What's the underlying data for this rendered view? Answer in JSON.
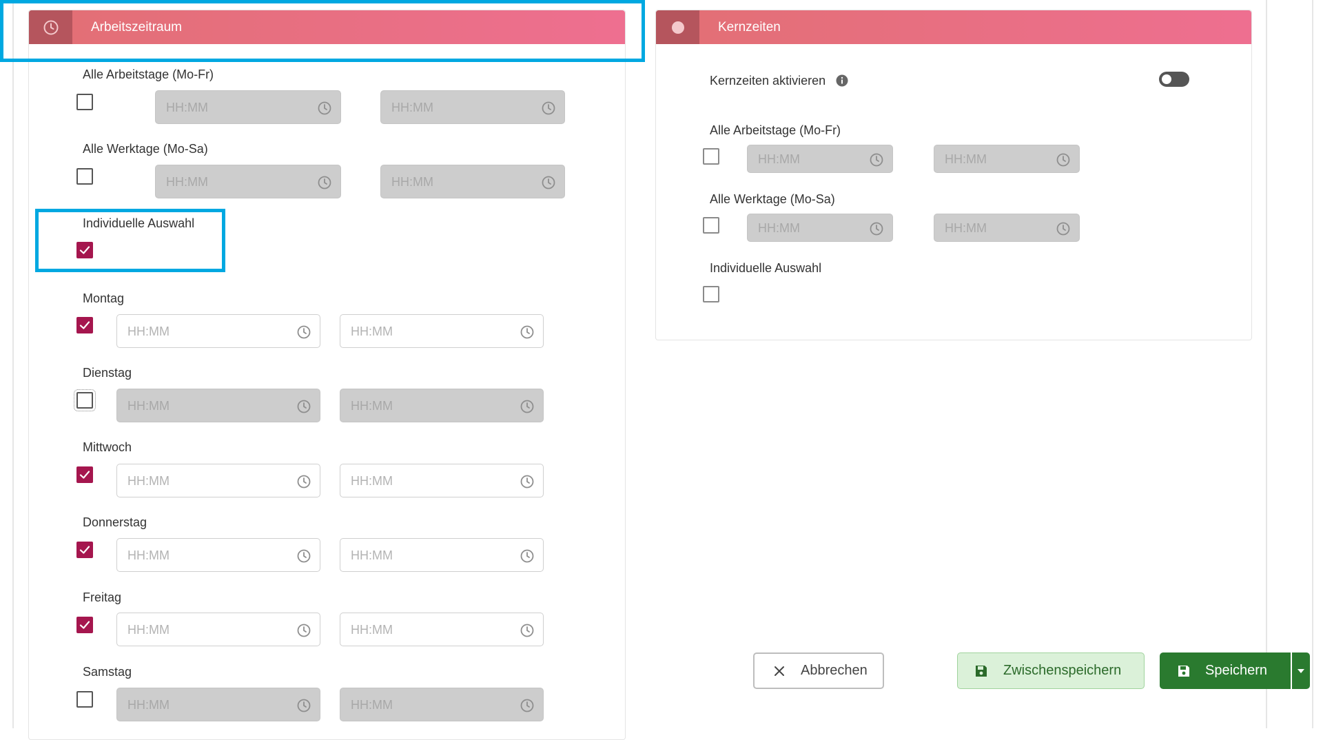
{
  "left_panel": {
    "title": "Arbeitszeitraum",
    "icon": "clock-icon",
    "rows": [
      {
        "label": "Alle Arbeitstage (Mo-Fr)",
        "checked": false,
        "from_placeholder": "HH:MM",
        "to_placeholder": "HH:MM"
      },
      {
        "label": "Alle Werktage (Mo-Sa)",
        "checked": false,
        "from_placeholder": "HH:MM",
        "to_placeholder": "HH:MM"
      },
      {
        "label": "Individuelle Auswahl",
        "checked": true
      },
      {
        "label": "Montag",
        "checked": true,
        "from_placeholder": "HH:MM",
        "to_placeholder": "HH:MM"
      },
      {
        "label": "Dienstag",
        "checked": false,
        "from_placeholder": "HH:MM",
        "to_placeholder": "HH:MM"
      },
      {
        "label": "Mittwoch",
        "checked": true,
        "from_placeholder": "HH:MM",
        "to_placeholder": "HH:MM"
      },
      {
        "label": "Donnerstag",
        "checked": true,
        "from_placeholder": "HH:MM",
        "to_placeholder": "HH:MM"
      },
      {
        "label": "Freitag",
        "checked": true,
        "from_placeholder": "HH:MM",
        "to_placeholder": "HH:MM"
      },
      {
        "label": "Samstag",
        "checked": false,
        "from_placeholder": "HH:MM",
        "to_placeholder": "HH:MM"
      }
    ]
  },
  "right_panel": {
    "title": "Kernzeiten",
    "icon": "circle-icon",
    "activate_label": "Kernzeiten aktivieren",
    "activate_on": false,
    "rows": [
      {
        "label": "Alle Arbeitstage (Mo-Fr)",
        "checked": false,
        "from_placeholder": "HH:MM",
        "to_placeholder": "HH:MM"
      },
      {
        "label": "Alle Werktage (Mo-Sa)",
        "checked": false,
        "from_placeholder": "HH:MM",
        "to_placeholder": "HH:MM"
      },
      {
        "label": "Individuelle Auswahl",
        "checked": false
      }
    ]
  },
  "actions": {
    "cancel_label": "Abbrechen",
    "interim_save_label": "Zwischenspeichern",
    "save_label": "Speichern"
  },
  "colors": {
    "header_gradient_start": "#e26f74",
    "header_gradient_end": "#ee6f90",
    "checkbox_checked": "#a5164e",
    "highlight": "#00a8e1",
    "save_green": "#2a7a2f"
  }
}
